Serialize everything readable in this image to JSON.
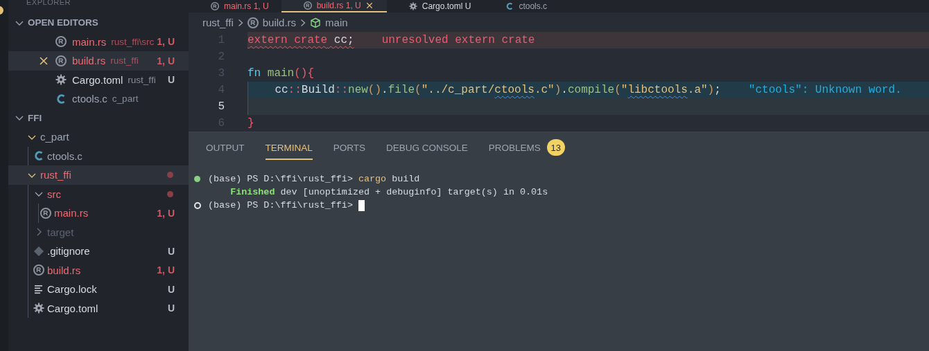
{
  "activity_bar": {
    "badge": true
  },
  "sidebar": {
    "header": "EXPLORER",
    "open_editors": {
      "title": "OPEN EDITORS",
      "expanded": true,
      "items": [
        {
          "name": "main.rs",
          "description": "rust_ffi\\src",
          "badge": "1, U",
          "kind": "rust",
          "has_errors": true,
          "selected": false,
          "close": false
        },
        {
          "name": "build.rs",
          "description": "rust_ffi",
          "badge": "1, U",
          "kind": "rust",
          "has_errors": true,
          "selected": true,
          "close": true
        },
        {
          "name": "Cargo.toml",
          "description": "rust_ffi",
          "badge": "U",
          "kind": "gear",
          "has_errors": false,
          "untracked": true,
          "selected": false,
          "close": false
        },
        {
          "name": "ctools.c",
          "description": "c_part",
          "kind": "c",
          "has_errors": false,
          "untracked": false,
          "selected": false,
          "close": false
        }
      ]
    },
    "folder": {
      "title": "FFI",
      "expanded": true,
      "items": [
        {
          "name": "c_part",
          "kind": "folder",
          "expanded": true,
          "has_errors": false,
          "ignored": false,
          "selected": false,
          "children": [
            {
              "name": "ctools.c",
              "kind": "c",
              "has_errors": false,
              "untracked": false,
              "selected": false
            }
          ]
        },
        {
          "name": "rust_ffi",
          "kind": "folder",
          "expanded": true,
          "has_errors": true,
          "dot": true,
          "selected": true,
          "children": [
            {
              "name": "src",
              "kind": "folder",
              "expanded": true,
              "has_errors": true,
              "dot": true,
              "selected": false,
              "children": [
                {
                  "name": "main.rs",
                  "kind": "rust",
                  "has_errors": true,
                  "badge": "1, U",
                  "selected": false
                }
              ]
            },
            {
              "name": "target",
              "kind": "folder",
              "expanded": false,
              "has_errors": false,
              "ignored": true,
              "selected": false
            },
            {
              "name": ".gitignore",
              "kind": "git",
              "has_errors": false,
              "untracked": true,
              "badge": "U",
              "selected": false
            },
            {
              "name": "build.rs",
              "kind": "rust",
              "has_errors": true,
              "badge": "1, U",
              "selected": false
            },
            {
              "name": "Cargo.lock",
              "kind": "lines",
              "has_errors": false,
              "untracked": true,
              "badge": "U",
              "selected": false
            },
            {
              "name": "Cargo.toml",
              "kind": "gear",
              "has_errors": false,
              "untracked": true,
              "badge": "U",
              "selected": false
            }
          ]
        }
      ]
    }
  },
  "editor": {
    "tabs": [
      {
        "name": "main.rs",
        "badge": "1, U",
        "kind": "rust",
        "has_errors": true,
        "selected": false
      },
      {
        "name": "build.rs",
        "badge": "1, U",
        "kind": "rust",
        "has_errors": true,
        "selected": true
      },
      {
        "name": "Cargo.toml",
        "badge": "U",
        "kind": "gear",
        "has_errors": false,
        "selected": false
      },
      {
        "name": "ctools.c",
        "kind": "c",
        "has_errors": false,
        "selected": false
      }
    ],
    "breadcrumb": [
      {
        "text": "rust_ffi",
        "kind": "folder"
      },
      {
        "text": "build.rs",
        "kind": "rust"
      },
      {
        "text": "main",
        "kind": "cube"
      }
    ],
    "lines": [
      {
        "number": "1",
        "kind": "error",
        "current": false,
        "tokens": [
          {
            "text": "extern crate",
            "kind": "keyword",
            "squiggle": true
          },
          {
            "text": " cc;",
            "kind": "plain",
            "squiggle": true
          }
        ],
        "diagnostic": "unresolved extern crate"
      },
      {
        "number": "2",
        "kind": "plain",
        "current": false
      },
      {
        "number": "3",
        "kind": "plain",
        "current": false,
        "tokens": [
          {
            "text": "fn",
            "kind": "storage"
          },
          {
            "text": " main",
            "kind": "function"
          },
          {
            "text": "(){",
            "kind": "punct"
          }
        ]
      },
      {
        "number": "4",
        "kind": "info",
        "current": false,
        "tokens": [
          {
            "text": "    cc",
            "kind": "plain"
          },
          {
            "text": "::",
            "kind": "punct"
          },
          {
            "text": "Build",
            "kind": "plain"
          },
          {
            "text": "::",
            "kind": "punct"
          },
          {
            "text": "new",
            "kind": "function"
          },
          {
            "text": "()",
            "kind": "paren"
          },
          {
            "text": ".",
            "kind": "plain"
          },
          {
            "text": "file",
            "kind": "function"
          },
          {
            "text": "(",
            "kind": "paren"
          },
          {
            "text": "\"../c_part/",
            "kind": "string"
          },
          {
            "text": "ctools",
            "kind": "string",
            "squiggle": true
          },
          {
            "text": ".c\"",
            "kind": "string"
          },
          {
            "text": ")",
            "kind": "paren"
          },
          {
            "text": ".",
            "kind": "plain"
          },
          {
            "text": "compile",
            "kind": "function"
          },
          {
            "text": "(",
            "kind": "paren"
          },
          {
            "text": "\"",
            "kind": "string"
          },
          {
            "text": "libctools",
            "kind": "string",
            "squiggle": true
          },
          {
            "text": ".a\"",
            "kind": "string"
          },
          {
            "text": ")",
            "kind": "paren"
          },
          {
            "text": ";",
            "kind": "plain"
          }
        ],
        "diagnostic": "\"ctools\": Unknown word."
      },
      {
        "number": "5",
        "kind": "plain",
        "current": true
      },
      {
        "number": "6",
        "kind": "plain",
        "current": false,
        "tokens": [
          {
            "text": "}",
            "kind": "punct"
          }
        ]
      }
    ]
  },
  "panel": {
    "tabs": [
      {
        "label": "OUTPUT",
        "selected": false
      },
      {
        "label": "TERMINAL",
        "selected": true
      },
      {
        "label": "PORTS",
        "selected": false
      },
      {
        "label": "DEBUG CONSOLE",
        "selected": false
      },
      {
        "label": "PROBLEMS",
        "selected": false,
        "count": "13"
      }
    ],
    "terminal": [
      {
        "kind": "success",
        "segments": [
          {
            "text": "(base) PS D:\\ffi\\rust_ffi> ",
            "kind": "plain"
          },
          {
            "text": "cargo",
            "kind": "command"
          },
          {
            "text": " build",
            "kind": "plain"
          }
        ]
      },
      {
        "kind": "output",
        "segments": [
          {
            "text": "    Finished",
            "kind": "success"
          },
          {
            "text": " dev [unoptimized + debuginfo] target(s) in 0.01s",
            "kind": "plain"
          }
        ]
      },
      {
        "kind": "idle",
        "cursor": true,
        "segments": [
          {
            "text": "(base) PS D:\\ffi\\rust_ffi> ",
            "kind": "plain"
          }
        ]
      }
    ]
  }
}
